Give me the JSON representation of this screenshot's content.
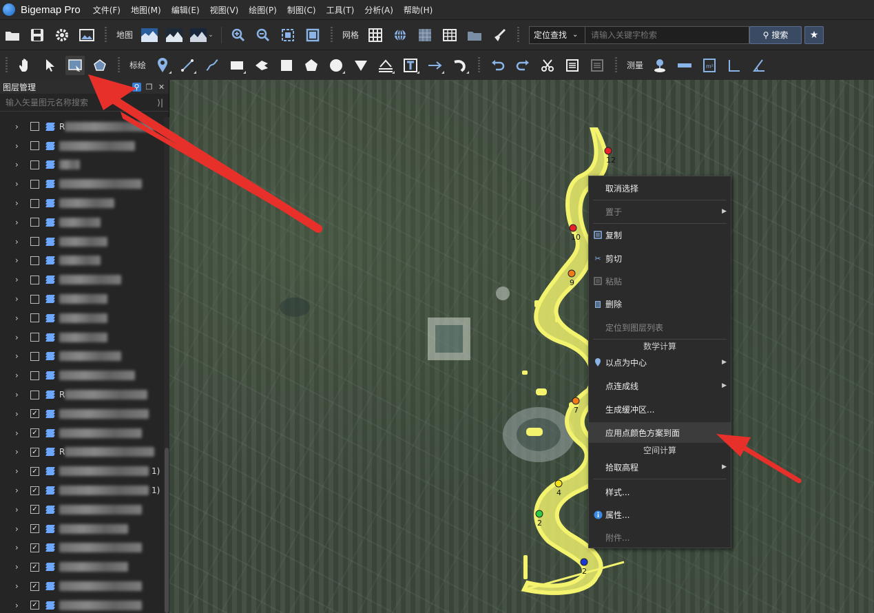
{
  "app": {
    "title": "Bigemap Pro"
  },
  "menu": [
    "文件(F)",
    "地图(M)",
    "编辑(E)",
    "视图(V)",
    "绘图(P)",
    "制图(C)",
    "工具(T)",
    "分析(A)",
    "帮助(H)"
  ],
  "toolbar1": {
    "map_label": "地图",
    "grid_label": "网格",
    "locate_select": "定位查找",
    "search_placeholder": "请输入关键字检索",
    "search_button": "搜索"
  },
  "toolbar2": {
    "draw_label": "标绘",
    "measure_label": "测量"
  },
  "layer_panel": {
    "title": "图层管理",
    "search_placeholder": "输入矢量图元名称搜索",
    "rows": [
      {
        "checked": false,
        "name": "R",
        "suffix": ""
      },
      {
        "checked": false,
        "name": "",
        "suffix": ""
      },
      {
        "checked": false,
        "name": "",
        "suffix": ""
      },
      {
        "checked": false,
        "name": "",
        "suffix": ""
      },
      {
        "checked": false,
        "name": "",
        "suffix": ""
      },
      {
        "checked": false,
        "name": "",
        "suffix": ""
      },
      {
        "checked": false,
        "name": "",
        "suffix": ""
      },
      {
        "checked": false,
        "name": "",
        "suffix": ""
      },
      {
        "checked": false,
        "name": "",
        "suffix": ""
      },
      {
        "checked": false,
        "name": "",
        "suffix": ""
      },
      {
        "checked": false,
        "name": "",
        "suffix": ""
      },
      {
        "checked": false,
        "name": "",
        "suffix": ""
      },
      {
        "checked": false,
        "name": "",
        "suffix": ""
      },
      {
        "checked": false,
        "name": "",
        "suffix": ""
      },
      {
        "checked": false,
        "name": "R",
        "suffix": ""
      },
      {
        "checked": true,
        "name": "",
        "suffix": ""
      },
      {
        "checked": true,
        "name": "",
        "suffix": ""
      },
      {
        "checked": true,
        "name": "R",
        "suffix": ""
      },
      {
        "checked": true,
        "name": "",
        "suffix": "1)"
      },
      {
        "checked": true,
        "name": "",
        "suffix": "1)"
      },
      {
        "checked": true,
        "name": "",
        "suffix": ""
      },
      {
        "checked": true,
        "name": "",
        "suffix": ""
      },
      {
        "checked": true,
        "name": "",
        "suffix": ""
      },
      {
        "checked": true,
        "name": "",
        "suffix": ""
      },
      {
        "checked": true,
        "name": "",
        "suffix": ""
      },
      {
        "checked": true,
        "name": "",
        "suffix": ""
      }
    ]
  },
  "map": {
    "markers": [
      {
        "label": "12",
        "color": "#e8202a"
      },
      {
        "label": "10",
        "color": "#e8202a"
      },
      {
        "label": "9",
        "color": "#f07b1d"
      },
      {
        "label": "7",
        "color": "#f07b1d"
      },
      {
        "label": "4",
        "color": "#f4e21b"
      },
      {
        "label": "2",
        "color": "#2ecc40"
      },
      {
        "label": "2",
        "color": "#1a37d6"
      }
    ],
    "river_color": "#f0f07a"
  },
  "context_menu": {
    "items": {
      "cancel_select": "取消选择",
      "place": "置于",
      "copy": "复制",
      "cut": "剪切",
      "paste": "粘贴",
      "delete": "删除",
      "locate_in_layer": "定位到图层列表",
      "math_group": "数学计算",
      "point_center": "以点为中心",
      "points_to_line": "点连成线",
      "buffer": "生成缓冲区...",
      "apply_color": "应用点颜色方案到面",
      "spatial_group": "空间计算",
      "elevation": "拾取高程",
      "style": "样式...",
      "properties": "属性...",
      "attachment": "附件..."
    }
  },
  "colors": {
    "arrow": "#e8302a",
    "accent": "#3a4a63"
  }
}
